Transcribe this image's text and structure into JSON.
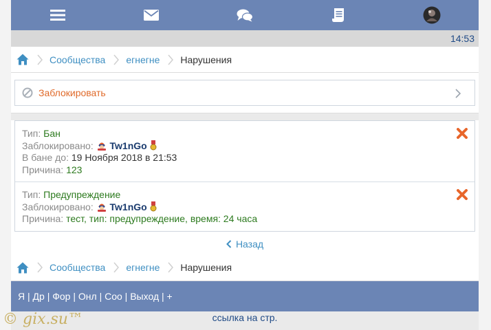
{
  "clock": "14:53",
  "colors": {
    "header": "#6b85b5",
    "accent_link": "#3f8fc2",
    "block": "#e06a2a",
    "value": "#2c7a1e",
    "delete": "#e8662b"
  },
  "topnav": [
    {
      "icon": "menu-icon"
    },
    {
      "icon": "mail-icon"
    },
    {
      "icon": "chat-icon"
    },
    {
      "icon": "document-icon"
    },
    {
      "icon": "avatar"
    }
  ],
  "breadcrumb": {
    "items": [
      "Сообщества",
      "егнегне"
    ],
    "current": "Нарушения"
  },
  "block": {
    "label": "Заблокировать"
  },
  "bans": [
    {
      "type_label": "Тип:",
      "type_value": "Бан",
      "blocked_label": "Заблокировано:",
      "user": "Tw1nGo",
      "until_label": "В бане до:",
      "until_value": "19 Ноября 2018 в 21:53",
      "reason_label": "Причина:",
      "reason_value": "123"
    },
    {
      "type_label": "Тип:",
      "type_value": "Предупреждение",
      "blocked_label": "Заблокировано:",
      "user": "Tw1nGo",
      "reason_label": "Причина:",
      "reason_value": "тест, тип: предупреждение, время: 24 часа"
    }
  ],
  "back": {
    "label": "Назад"
  },
  "footer": {
    "links": [
      "Я",
      "Др",
      "Фор",
      "Онл",
      "Соо",
      "Выход",
      "+"
    ]
  },
  "link_page": "ссылка на стр.",
  "watermark": "© gix.su™"
}
